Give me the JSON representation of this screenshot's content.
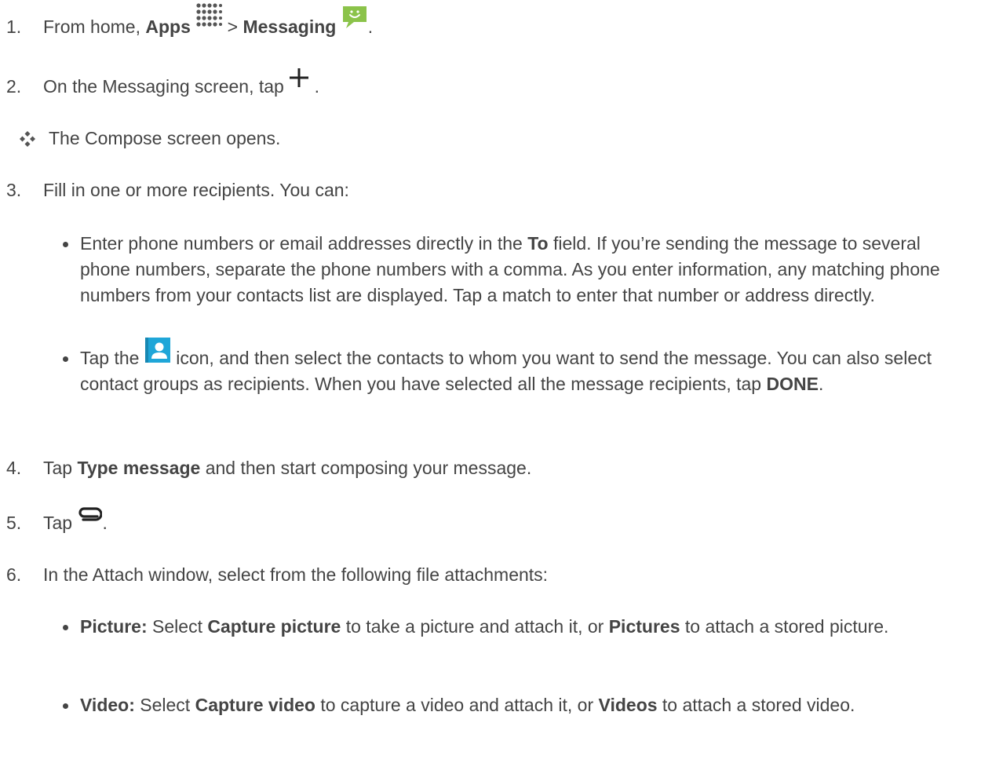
{
  "steps": [
    {
      "num": "1.",
      "t1": "From home,",
      "b1": "Apps",
      "t2": ">",
      "b2": "Messaging",
      "t3": "."
    },
    {
      "num": "2.",
      "t1": "On the Messaging screen, tap",
      "t2": "."
    },
    {
      "result": "The Compose screen opens."
    },
    {
      "num": "3.",
      "t1": "Fill in one or more recipients. You can:",
      "bullets": [
        {
          "t1": "Enter phone numbers or email addresses directly in the",
          "b1": "To",
          "t2": "field. If you’re sending the message to several phone numbers, separate the phone numbers with a comma. As you enter information, any matching phone numbers from your contacts list are displayed. Tap a match to enter that number or address directly."
        },
        {
          "t1": "Tap the",
          "t2": "icon, and then select the contacts to whom you want to send the message. You can also select contact groups as recipients. When you have selected all the message recipients, tap",
          "b1": "DONE",
          "t3": "."
        }
      ]
    },
    {
      "num": "4.",
      "t1": "Tap",
      "b1": "Type message",
      "t2": "and then start composing your message."
    },
    {
      "num": "5.",
      "t1": "Tap",
      "t2": "."
    },
    {
      "num": "6.",
      "t1": "In the Attach window, select from the following file attachments:",
      "bullets": [
        {
          "b1": "Picture:",
          "t1": "Select",
          "b2": "Capture picture",
          "t2": "to take a picture and attach it, or",
          "b3": "Pictures",
          "t3": "to attach a stored picture."
        },
        {
          "b1": "Video:",
          "t1": "Select",
          "b2": "Capture video",
          "t2": "to capture a video and attach it, or",
          "b3": "Videos",
          "t3": "to attach a stored video."
        }
      ]
    }
  ],
  "icons": {
    "apps": "apps-grid-icon",
    "messaging": "messaging-icon",
    "add": "plus-icon",
    "result": "result-diamond-icon",
    "contacts": "contacts-icon",
    "attach": "paperclip-icon"
  },
  "colors": {
    "text": "#444444",
    "messaging_green": "#8BC34A",
    "contacts_blue": "#1FA6D8"
  }
}
